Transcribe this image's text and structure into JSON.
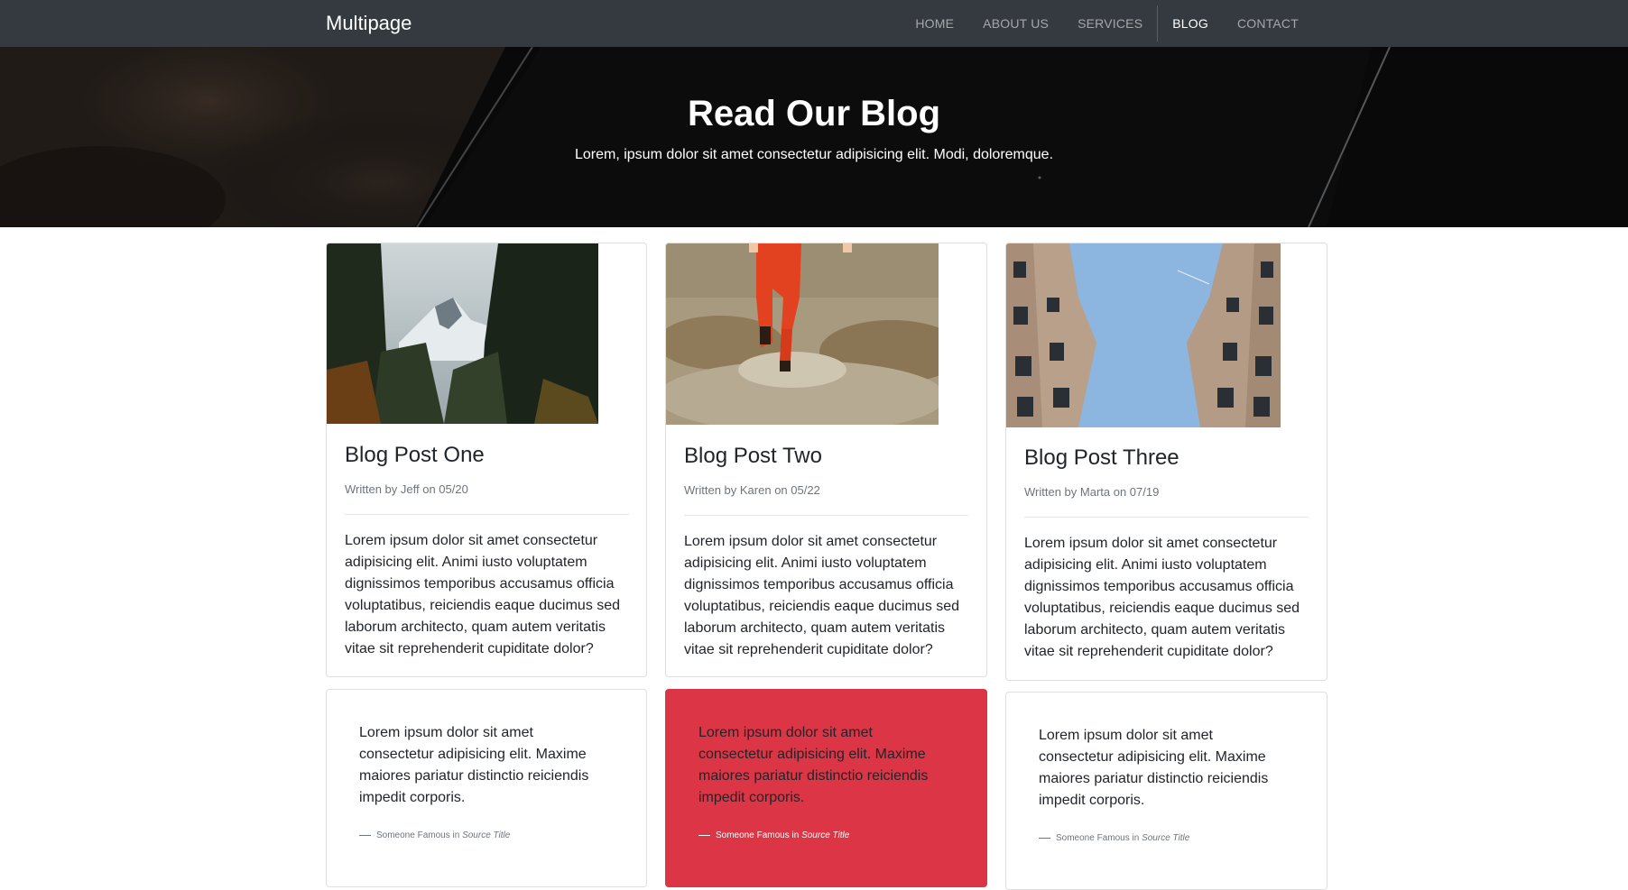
{
  "navbar": {
    "brand": "Multipage",
    "items": [
      {
        "label": "HOME",
        "active": false
      },
      {
        "label": "ABOUT US",
        "active": false
      },
      {
        "label": "SERVICES",
        "active": false
      },
      {
        "label": "BLOG",
        "active": true
      },
      {
        "label": "CONTACT",
        "active": false
      }
    ]
  },
  "hero": {
    "title": "Read Our Blog",
    "subtitle": "Lorem, ipsum dolor sit amet consectetur adipisicing elit. Modi, doloremque."
  },
  "posts": [
    {
      "title": "Blog Post One",
      "meta": "Written by Jeff on 05/20",
      "body": "Lorem ipsum dolor sit amet consectetur adipisicing elit. Animi iusto voluptatem dignissimos temporibus accusamus officia voluptatibus, reiciendis eaque ducimus sed laborum architecto, quam autem veritatis vitae sit reprehenderit cupiditate dolor?",
      "image": "mountain-forest-photo"
    },
    {
      "title": "Blog Post Two",
      "meta": "Written by Karen on 05/22",
      "body": "Lorem ipsum dolor sit amet consectetur adipisicing elit. Animi iusto voluptatem dignissimos temporibus accusamus officia voluptatibus, reiciendis eaque ducimus sed laborum architecto, quam autem veritatis vitae sit reprehenderit cupiditate dolor?",
      "image": "red-jumpsuit-field-photo"
    },
    {
      "title": "Blog Post Three",
      "meta": "Written by Marta on 07/19",
      "body": "Lorem ipsum dolor sit amet consectetur adipisicing elit. Animi iusto voluptatem dignissimos temporibus accusamus officia voluptatibus, reiciendis eaque ducimus sed laborum architecto, quam autem veritatis vitae sit reprehenderit cupiditate dolor?",
      "image": "buildings-sky-photo"
    }
  ],
  "quotes": [
    {
      "text": "Lorem ipsum dolor sit amet consectetur adipisicing elit. Maxime maiores pariatur distinctio reiciendis impedit corporis.",
      "author": "Someone Famous",
      "in": "in",
      "source": "Source Title",
      "style": "white"
    },
    {
      "text": "Lorem ipsum dolor sit amet consectetur adipisicing elit. Maxime maiores pariatur distinctio reiciendis impedit corporis.",
      "author": "Someone Famous",
      "in": "in",
      "source": "Source Title",
      "style": "red"
    },
    {
      "text": "Lorem ipsum dolor sit amet consectetur adipisicing elit. Maxime maiores pariatur distinctio reiciendis impedit corporis.",
      "author": "Someone Famous",
      "in": "in",
      "source": "Source Title",
      "style": "white"
    }
  ],
  "colors": {
    "navbar": "#343a40",
    "danger": "#dc3545"
  }
}
